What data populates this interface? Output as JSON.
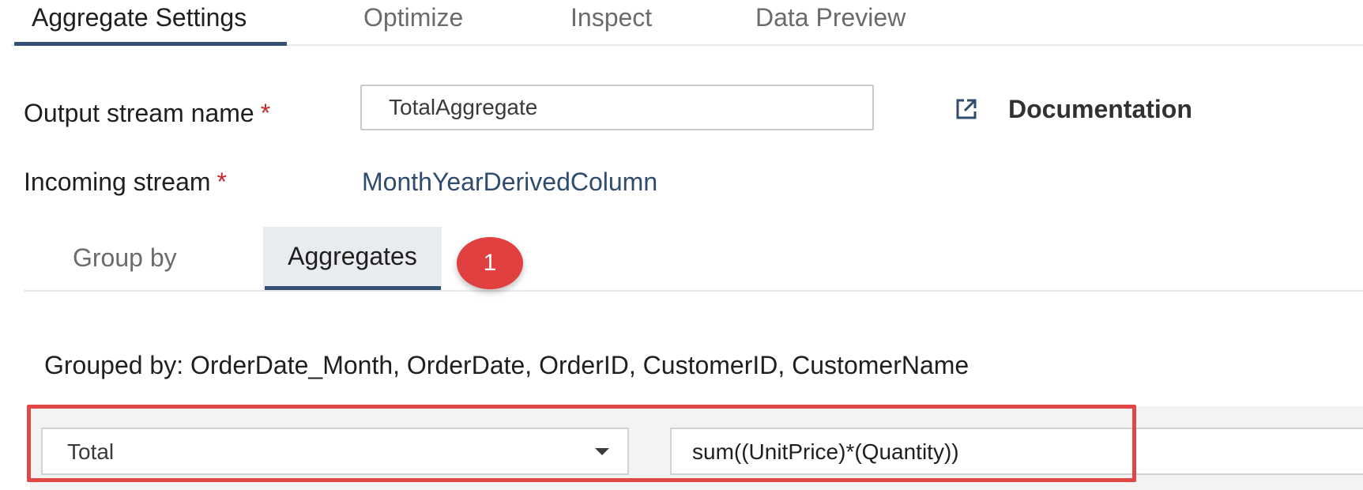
{
  "top_tabs": [
    {
      "label": "Aggregate Settings",
      "active": true
    },
    {
      "label": "Optimize",
      "active": false
    },
    {
      "label": "Inspect",
      "active": false
    },
    {
      "label": "Data Preview",
      "active": false
    }
  ],
  "form": {
    "output_stream": {
      "label": "Output stream name",
      "required_marker": "*",
      "value": "TotalAggregate"
    },
    "documentation": {
      "label": "Documentation",
      "icon": "external-link-icon"
    },
    "incoming_stream": {
      "label": "Incoming stream",
      "required_marker": "*",
      "value": "MonthYearDerivedColumn"
    }
  },
  "sub_tabs": [
    {
      "label": "Group by",
      "active": false
    },
    {
      "label": "Aggregates",
      "active": true
    }
  ],
  "step_badge": "1",
  "grouped_by": "Grouped by: OrderDate_Month, OrderDate, OrderID, CustomerID, CustomerName",
  "aggregate_row": {
    "column": "Total",
    "expression": "sum((UnitPrice)*(Quantity))"
  },
  "colors": {
    "accent": "#345175",
    "required": "#c8262f",
    "highlight": "#e04848",
    "badge": "#e0403f",
    "link_value": "#2f4b6e"
  }
}
